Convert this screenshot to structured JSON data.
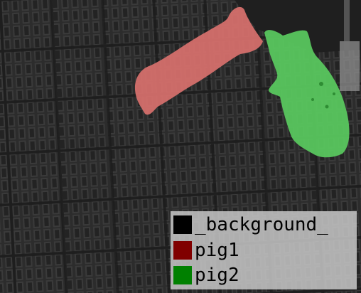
{
  "image": {
    "description_kind": "segmentation-overlay",
    "background_color": "#2b2b2b"
  },
  "legend": {
    "items": [
      {
        "label": "_background_",
        "color": "#000000"
      },
      {
        "label": "pig1",
        "color": "#800000"
      },
      {
        "label": "pig2",
        "color": "#008000"
      }
    ]
  },
  "overlays": {
    "pig1": {
      "fill": "#d9716e"
    },
    "pig2": {
      "fill": "#58c65e"
    }
  }
}
